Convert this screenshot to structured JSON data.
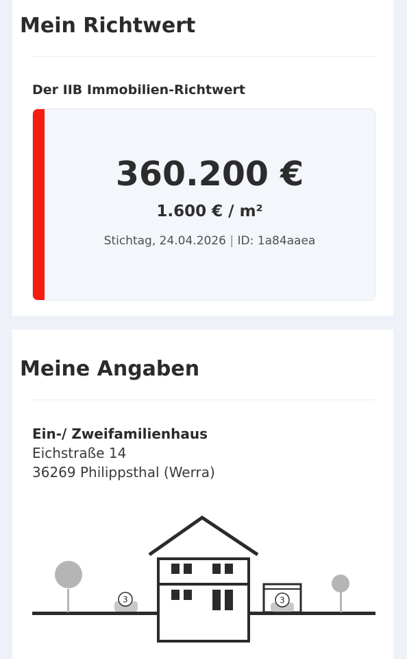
{
  "richtwert": {
    "title": "Mein Richtwert",
    "subtitle": "Der IIB Immobilien-Richtwert",
    "price": "360.200 €",
    "price_per_m2": "1.600 € / m²",
    "stichtag": "Stichtag, 24.04.2026",
    "separator": "|",
    "id_text": "ID: 1a84aaea",
    "accent_color": "#f41d10"
  },
  "angaben": {
    "title": "Meine Angaben",
    "property_type": "Ein-/ Zweifamilienhaus",
    "street": "Eichstraße 14",
    "city": "36269 Philippsthal (Werra)",
    "illustration": {
      "icons": [
        "tree-icon",
        "car-icon",
        "house-icon",
        "garage-icon",
        "tree-icon"
      ],
      "car_count": "3",
      "garage_count": "3"
    }
  }
}
